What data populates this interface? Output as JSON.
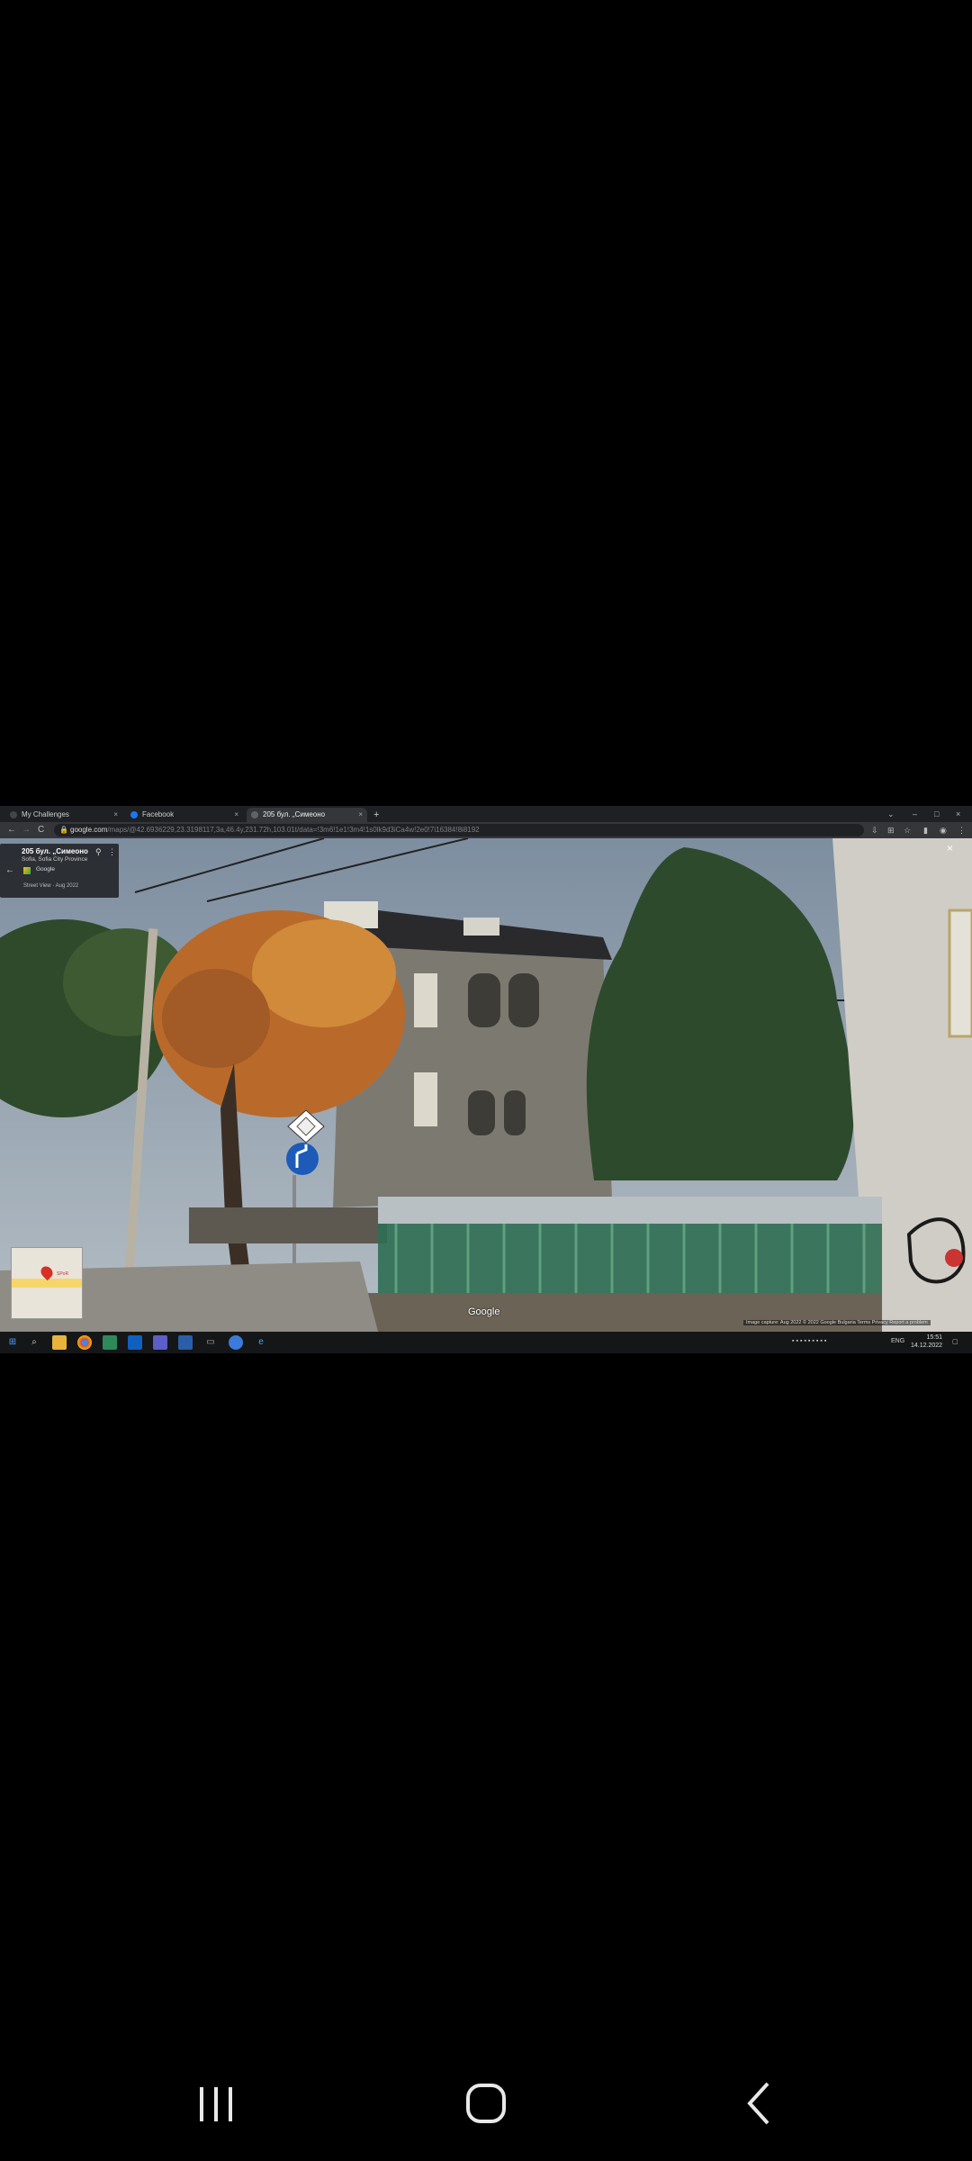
{
  "browser": {
    "tabs": [
      {
        "label": "My Challenges",
        "active": false,
        "close": "×"
      },
      {
        "label": "Facebook",
        "active": false,
        "close": "×"
      },
      {
        "label": "205 бул. „Симеоно",
        "active": true,
        "close": "×"
      }
    ],
    "new_tab": "+",
    "window_controls": {
      "chevron": "⌄",
      "minimize": "–",
      "maximize": "□",
      "close": "×"
    },
    "nav": {
      "back": "←",
      "forward": "→",
      "reload": "C"
    },
    "url_host": "google.com",
    "url_path": "/maps/@42.6936229,23.3198117,3a,46.4y,231.72h,103.01t/data=!3m6!1e1!3m4!1s0lk9d3iCa4w!2e0!7i16384!8i8192",
    "toolbar_icons": [
      "download-icon",
      "extension-icon",
      "star-icon",
      "sidepanel-icon",
      "profile-icon",
      "menu-icon"
    ]
  },
  "streetview": {
    "place_title": "205 бул. „Симеоно",
    "place_subtitle": "Sofia, Sofia City Province",
    "source": "Google",
    "date_label": "Street View · Aug 2022",
    "back_icon": "←",
    "pin_icon": "⚲",
    "more_icon": "⋮",
    "close_icon": "×",
    "minimap_label": "SPoR",
    "watermark": "Google",
    "credits": "Image capture: Aug 2022  © 2022 Google  Bulgaria  Terms  Privacy  Report a problem"
  },
  "taskbar": {
    "time": "15:51",
    "date": "14.12.2022",
    "lang": "ENG"
  },
  "colors": {
    "sky": "#8d9fb1",
    "tree_autumn": "#c9772f",
    "tree_green": "#2f4a2c",
    "fence": "#2f6e53",
    "building": "#7c7a70"
  }
}
